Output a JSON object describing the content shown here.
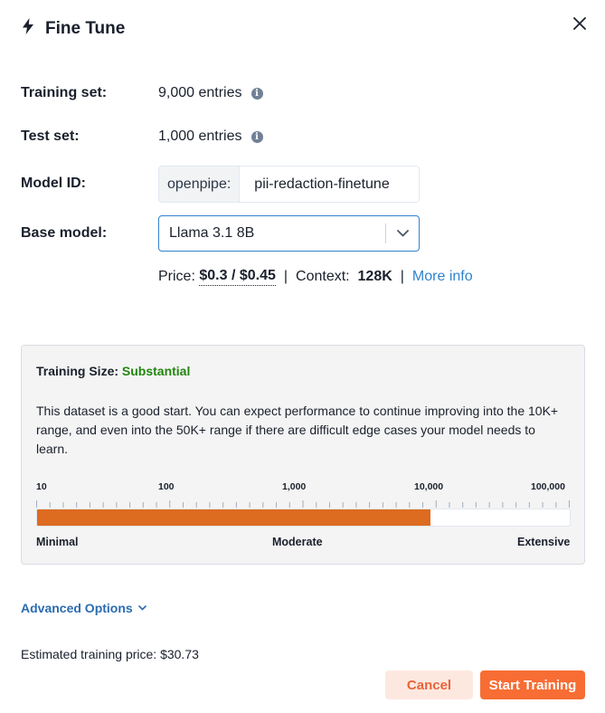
{
  "modal": {
    "title": "Fine Tune",
    "title_icon": "lightning-icon",
    "close_icon": "close-icon"
  },
  "fields": {
    "training_set_label": "Training set:",
    "training_set_value": "9,000 entries",
    "test_set_label": "Test set:",
    "test_set_value": "1,000 entries",
    "model_id_label": "Model ID:",
    "model_id_prefix": "openpipe:",
    "model_id_value": "pii-redaction-finetune",
    "base_model_label": "Base model:",
    "base_model_value": "Llama 3.1 8B"
  },
  "pricing": {
    "price_label": "Price:",
    "price_value": "$0.3 / $0.45",
    "separator": "|",
    "context_label": "Context:",
    "context_value": "128K",
    "more_info": "More info"
  },
  "training_size": {
    "heading_label": "Training Size:",
    "heading_value": "Substantial",
    "heading_color": "#23850f",
    "description": "This dataset is a good start. You can expect performance to continue improving into the 10K+ range, and even into the 50K+ range if there are difficult edge cases your model needs to learn.",
    "scale_labels": [
      "10",
      "100",
      "1,000",
      "10,000",
      "100,000"
    ],
    "range_labels": {
      "low": "Minimal",
      "mid": "Moderate",
      "high": "Extensive"
    },
    "entries": 9000,
    "fill_fraction": 0.7385,
    "fill_color": "#dd6b20"
  },
  "advanced_options": "Advanced Options",
  "estimate": "Estimated training price: $30.73",
  "buttons": {
    "cancel": "Cancel",
    "start": "Start Training"
  }
}
